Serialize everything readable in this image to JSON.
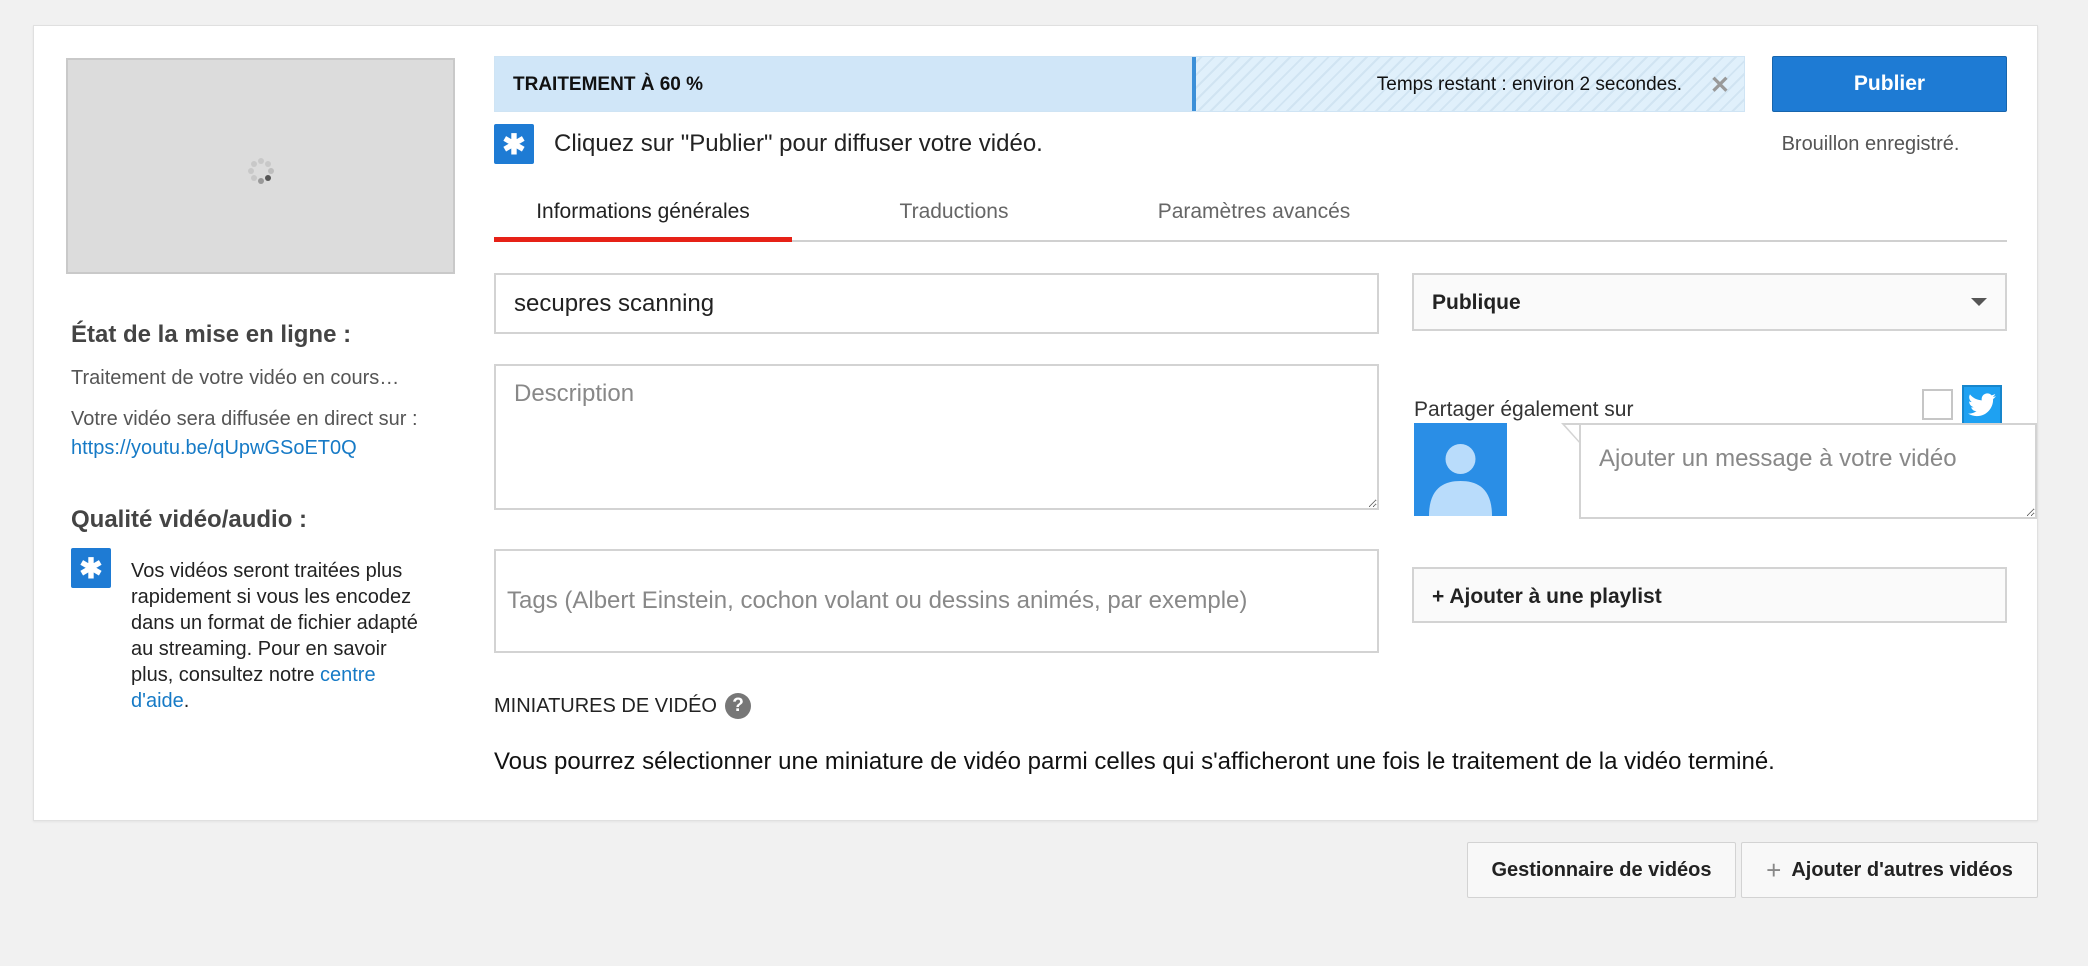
{
  "upload_status": {
    "heading": "État de la mise en ligne :",
    "processing": "Traitement de votre vidéo en cours…",
    "live_text": "Votre vidéo sera diffusée en direct sur :",
    "live_link": "https://youtu.be/qUpwGSoET0Q"
  },
  "quality": {
    "heading": "Qualité vidéo/audio :",
    "text": "Vos vidéos seront traitées plus rapidement si vous les encodez dans un format de fichier adapté au streaming. Pour en savoir plus, consultez notre",
    "link": "centre d'aide",
    "suffix": "."
  },
  "progress": {
    "label": "TRAITEMENT À 60 %",
    "percent": 60,
    "remaining": "Temps restant : environ 2 secondes.",
    "close_icon": "close-icon"
  },
  "publish_button": "Publier",
  "draft_status": "Brouillon enregistré.",
  "hint": "Cliquez sur \"Publier\" pour diffuser votre vidéo.",
  "tabs": [
    {
      "label": "Informations générales",
      "active": true
    },
    {
      "label": "Traductions",
      "active": false
    },
    {
      "label": "Paramètres avancés",
      "active": false
    }
  ],
  "form": {
    "title_value": "secupres scanning",
    "description_placeholder": "Description",
    "tags_placeholder": "Tags (Albert Einstein, cochon volant ou dessins animés, par exemple)"
  },
  "privacy": {
    "selected": "Publique"
  },
  "share": {
    "label": "Partager également sur",
    "message_placeholder": "Ajouter un message à votre vidéo"
  },
  "playlist_button": "+ Ajouter à une playlist",
  "thumbnails": {
    "heading": "MINIATURES DE VIDÉO",
    "help": "?",
    "text": "Vous pourrez sélectionner une miniature de vidéo parmi celles qui s'afficheront une fois le traitement de la vidéo terminé."
  },
  "footer": {
    "manager_button": "Gestionnaire de vidéos",
    "add_button": "Ajouter d'autres vidéos"
  },
  "colors": {
    "accent": "#1e7bd4",
    "tab_active": "#e62117",
    "twitter": "#1ea1f2",
    "link": "#167ac6"
  }
}
